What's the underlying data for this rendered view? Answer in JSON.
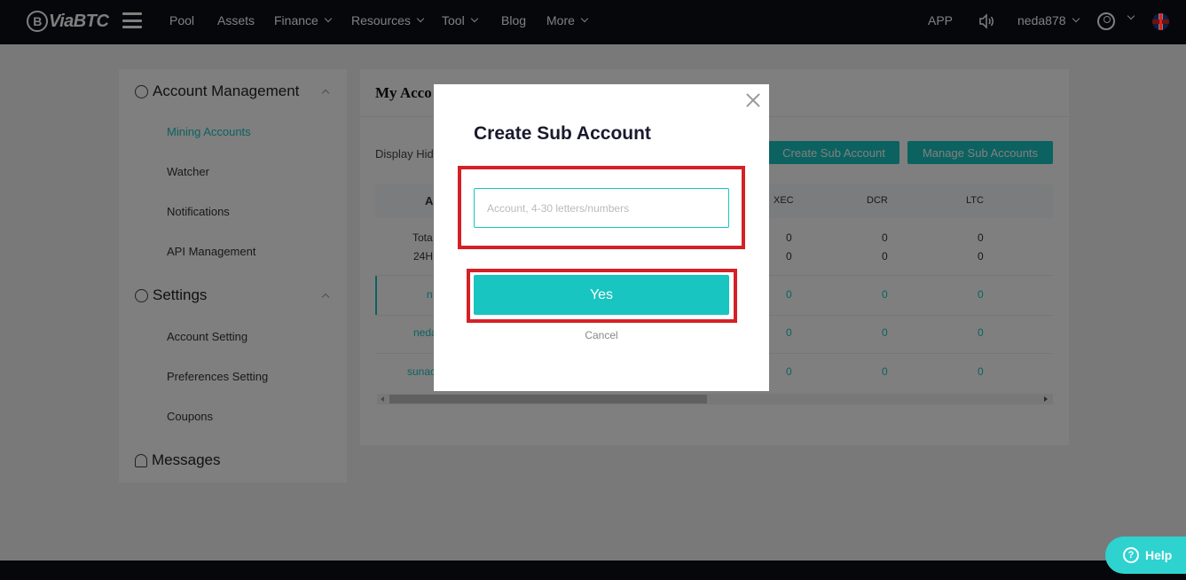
{
  "nav": {
    "logo": "ViaBTC",
    "logo_mark": "B",
    "items": [
      "Pool",
      "Assets",
      "Finance",
      "Resources",
      "Tool",
      "Blog",
      "More"
    ],
    "app": "APP",
    "username": "neda878"
  },
  "sidebar": {
    "account_management": "Account Management",
    "account_items": [
      "Mining Accounts",
      "Watcher",
      "Notifications",
      "API Management"
    ],
    "settings": "Settings",
    "settings_items": [
      "Account Setting",
      "Preferences Setting",
      "Coupons"
    ],
    "messages": "Messages"
  },
  "main": {
    "title": "My Acco",
    "display_hidden": "Display Hid",
    "create_sub_account": "Create Sub Account",
    "manage_sub_accounts": "Manage Sub Accounts",
    "col_partial": "A",
    "columns": [
      "XEC",
      "DCR",
      "LTC"
    ],
    "summary_labels": [
      "Tota",
      "24H"
    ],
    "summary_values": [
      [
        "0",
        "0",
        "0"
      ],
      [
        "0",
        "0",
        "0"
      ]
    ],
    "rows": [
      {
        "name": "n",
        "values": [
          "0",
          "0",
          "0"
        ]
      },
      {
        "name": "neda",
        "values": [
          "0",
          "0",
          "0"
        ]
      },
      {
        "name": "sunac",
        "values": [
          "0",
          "0",
          "0"
        ]
      }
    ]
  },
  "modal": {
    "title": "Create Sub Account",
    "input_placeholder": "Account, 4-30 letters/numbers",
    "input_value": "",
    "yes": "Yes",
    "cancel": "Cancel"
  },
  "help": {
    "label": "Help",
    "glyph": "?"
  },
  "colors": {
    "accent": "#18c5c0",
    "highlight": "#d42126",
    "nav_bg": "#0b0e15"
  }
}
